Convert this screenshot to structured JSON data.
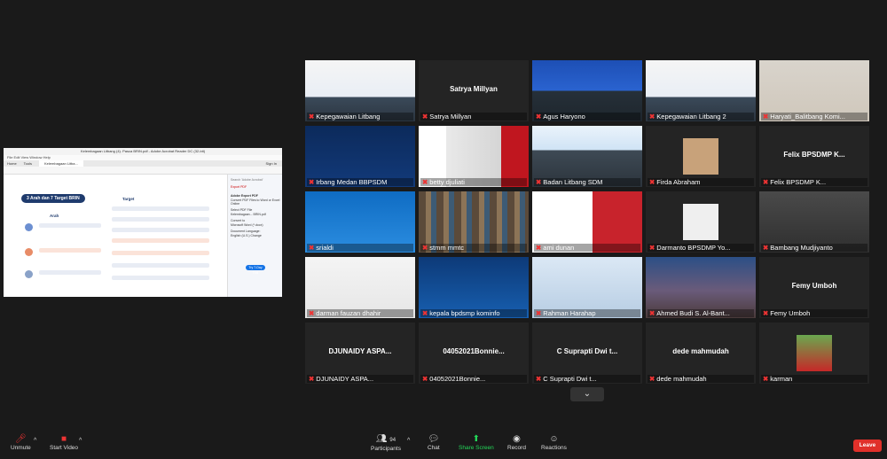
{
  "shared_screen": {
    "window_title": "Kelembagaan Litbang (4). Pasca BRIN.pdf - Adobe Acrobat Reader DC (32-bit)",
    "menu": "File  Edit  View  Window  Help",
    "tabs": [
      "Home",
      "Tools",
      "Kelembagaan Litba..."
    ],
    "sign_in": "Sign In",
    "zoom": "77.5%",
    "doc_banner": "3 Arah dan 7 Target BRIN",
    "col_arah": "Arah",
    "col_target": "Target",
    "side_search": "Search 'Adobe Acrobat'",
    "side_export": "Export PDF",
    "side_heading": "Adobe Export PDF",
    "side_desc": "Convert PDF Files to Word or Excel Online",
    "side_select": "Select PDF File",
    "side_file": "Kelembagaan... BRIN.pdf",
    "side_convert_to": "Convert to",
    "side_format": "Microsoft Word (*.docx)",
    "side_lang": "Document Language:",
    "side_lang_val": "English (U.S.) Change",
    "side_btn": "Try 7-Day Trial"
  },
  "participants": [
    {
      "name": "Kepegawaian Litbang",
      "video": "person-logo"
    },
    {
      "name": "Satrya Millyan",
      "video": "none"
    },
    {
      "name": "Agus Haryono",
      "video": "person-blue"
    },
    {
      "name": "Kepegawaian Litbang 2",
      "video": "person-logo"
    },
    {
      "name": "Haryati_Balitbang Komi...",
      "video": "person-light"
    },
    {
      "name": "Irbang Medan BBPSDM",
      "video": "bigdata"
    },
    {
      "name": "betty djuliati",
      "video": "person-red"
    },
    {
      "name": "Badan Litbang SDM",
      "video": "person-banner"
    },
    {
      "name": "Firda Abraham",
      "video": "small-photo"
    },
    {
      "name": "Felix BPSDMP K...",
      "video": "none"
    },
    {
      "name": "srialdi",
      "video": "blue-slide"
    },
    {
      "name": "stmm mmtc",
      "video": "bookshelf"
    },
    {
      "name": "ami dunan",
      "video": "dirgahayu"
    },
    {
      "name": "Darmanto BPSDMP Yo...",
      "video": "white-square"
    },
    {
      "name": "Bambang Mudjiyanto",
      "video": "person-room"
    },
    {
      "name": "darman fauzan dhahir",
      "video": "person-white"
    },
    {
      "name": "kepala bpdsmp kominfo",
      "video": "nodeit"
    },
    {
      "name": "Rahman Harahap",
      "video": "person-blue2"
    },
    {
      "name": "Ahmed Budi S. Al-Bant...",
      "video": "city"
    },
    {
      "name": "Femy Umboh",
      "video": "none"
    },
    {
      "name": "DJUNAIDY ASPA...",
      "video": "none"
    },
    {
      "name": "04052021Bonnie...",
      "video": "none"
    },
    {
      "name": "C Suprapti Dwi t...",
      "video": "none"
    },
    {
      "name": "dede mahmudah",
      "video": "none"
    },
    {
      "name": "karman",
      "video": "chili"
    }
  ],
  "speaking_index": 7,
  "toolbar": {
    "unmute": "Unmute",
    "start_video": "Start Video",
    "participants": "Participants",
    "participants_count": "94",
    "chat": "Chat",
    "share_screen": "Share Screen",
    "record": "Record",
    "reactions": "Reactions",
    "leave": "Leave"
  },
  "colors": {
    "background": "#1a1a1a",
    "tile": "#242424",
    "speaking": "#7bd53f",
    "leave": "#e0302a",
    "share": "#23d959"
  }
}
